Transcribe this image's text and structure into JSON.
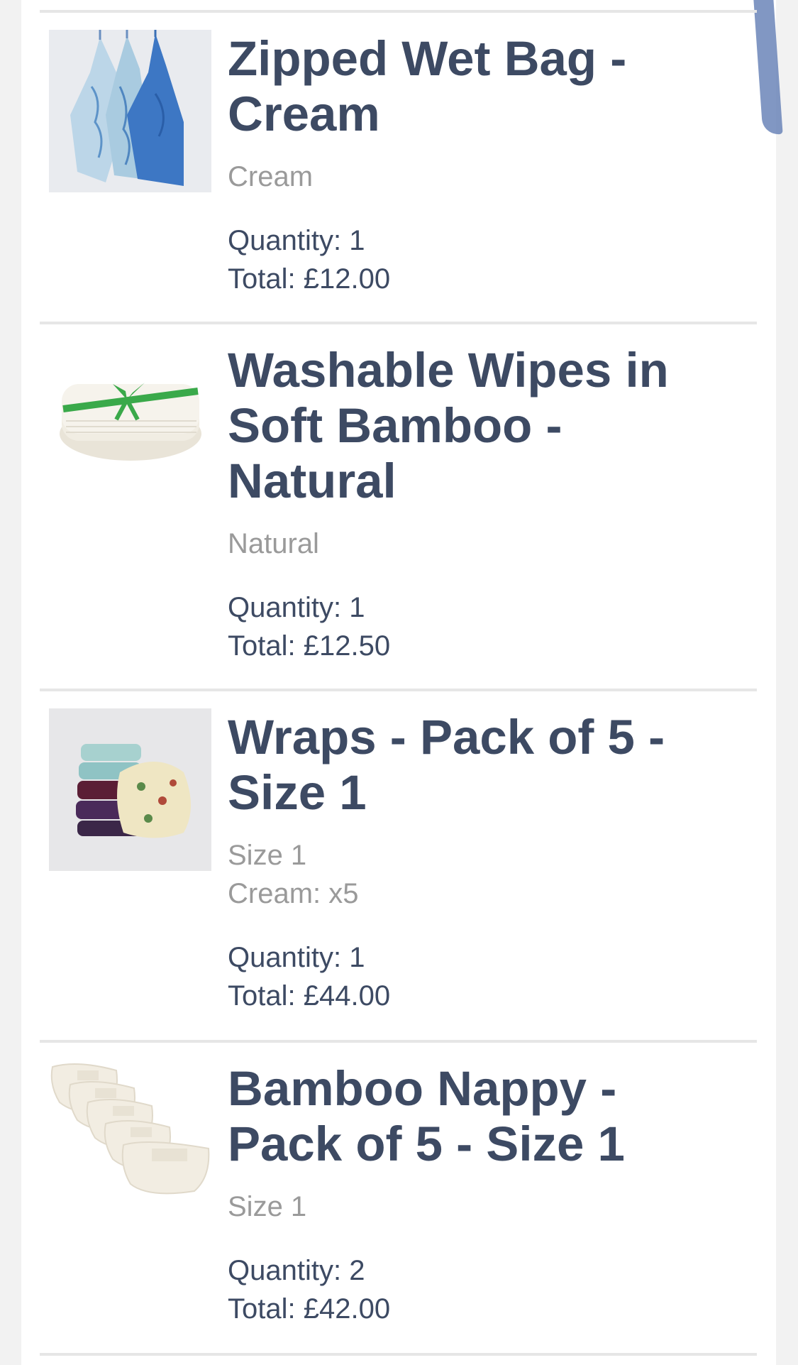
{
  "items": [
    {
      "title": "Zipped Wet Bag - Cream",
      "image": "wet-bag-image",
      "variant_lines": [
        "Cream"
      ],
      "quantity": "Quantity: 1",
      "total": "Total: £12.00"
    },
    {
      "title": "Washable Wipes in Soft Bamboo - Natural",
      "image": "bamboo-wipes-image",
      "variant_lines": [
        "Natural"
      ],
      "quantity": "Quantity: 1",
      "total": "Total: £12.50"
    },
    {
      "title": "Wraps - Pack of 5 - Size 1",
      "image": "wraps-image",
      "variant_lines": [
        "Size 1",
        "Cream: x5"
      ],
      "quantity": "Quantity: 1",
      "total": "Total: £44.00"
    },
    {
      "title": "Bamboo Nappy - Pack of 5 - Size 1",
      "image": "bamboo-nappy-image",
      "variant_lines": [
        "Size 1"
      ],
      "quantity": "Quantity: 2",
      "total": "Total: £42.00"
    }
  ],
  "colors": {
    "title": "#3d4a63",
    "variant": "#9a9a9a",
    "divider": "#e6e6e6"
  }
}
